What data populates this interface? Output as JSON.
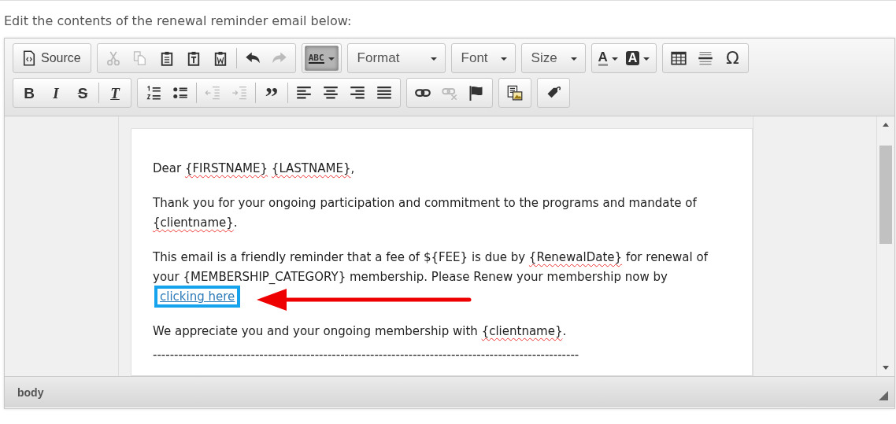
{
  "instruction": "Edit the contents of the renewal reminder email below:",
  "toolbar": [
    [
      [
        {
          "kind": "button",
          "label": "Source"
        }
      ],
      [
        {
          "kind": "icon",
          "disabled": true,
          "pressed": false
        },
        {
          "kind": "icon",
          "disabled": true,
          "pressed": false
        },
        {
          "kind": "icon",
          "disabled": false,
          "pressed": false
        },
        {
          "kind": "icon",
          "disabled": false,
          "pressed": false
        },
        {
          "kind": "icon",
          "disabled": false,
          "pressed": false
        },
        {
          "kind": "separator"
        },
        {
          "kind": "icon",
          "disabled": false,
          "pressed": false
        },
        {
          "kind": "icon",
          "disabled": true,
          "pressed": false
        }
      ],
      [
        {
          "kind": "glyph",
          "text": "ABC",
          "disabled": false,
          "pressed": true
        }
      ],
      [
        {
          "kind": "combo",
          "label": "Format"
        }
      ],
      [
        {
          "kind": "combo",
          "label": "Font"
        }
      ],
      [
        {
          "kind": "combo",
          "label": "Size"
        }
      ],
      [
        {
          "kind": "glyph",
          "text": "A",
          "disabled": false,
          "pressed": false
        },
        {
          "kind": "glyph",
          "text": "A",
          "disabled": false,
          "pressed": false
        }
      ],
      [
        {
          "kind": "icon",
          "disabled": false,
          "pressed": false
        },
        {
          "kind": "icon",
          "disabled": false,
          "pressed": false
        },
        {
          "kind": "glyph",
          "text": "Ω",
          "disabled": false,
          "pressed": false
        }
      ]
    ],
    [
      [
        {
          "kind": "glyph",
          "text": "B",
          "disabled": false,
          "pressed": false
        },
        {
          "kind": "glyph",
          "text": "I",
          "disabled": false,
          "pressed": false
        },
        {
          "kind": "glyph",
          "text": "S",
          "disabled": false,
          "pressed": false
        },
        {
          "kind": "separator"
        },
        {
          "kind": "glyph",
          "text": "T",
          "disabled": false,
          "pressed": false
        }
      ],
      [
        {
          "kind": "icon",
          "disabled": false,
          "pressed": false
        },
        {
          "kind": "icon",
          "disabled": false,
          "pressed": false
        },
        {
          "kind": "separator"
        },
        {
          "kind": "icon",
          "disabled": true,
          "pressed": false
        },
        {
          "kind": "icon",
          "disabled": true,
          "pressed": false
        },
        {
          "kind": "separator"
        },
        {
          "kind": "glyph",
          "text": "”",
          "disabled": false,
          "pressed": false
        },
        {
          "kind": "separator"
        },
        {
          "kind": "icon",
          "disabled": false,
          "pressed": false
        },
        {
          "kind": "icon",
          "disabled": false,
          "pressed": false
        },
        {
          "kind": "icon",
          "disabled": false,
          "pressed": false
        },
        {
          "kind": "icon",
          "disabled": false,
          "pressed": false
        }
      ],
      [
        {
          "kind": "icon",
          "disabled": false,
          "pressed": false
        },
        {
          "kind": "icon",
          "disabled": true,
          "pressed": false
        },
        {
          "kind": "icon",
          "disabled": false,
          "pressed": false
        }
      ],
      [
        {
          "kind": "icon",
          "disabled": false,
          "pressed": false
        }
      ],
      [
        {
          "kind": "icon",
          "disabled": false,
          "pressed": false
        }
      ]
    ]
  ],
  "paragraphs": [
    [
      {
        "text": "Dear "
      },
      {
        "text": "{FIRSTNAME}",
        "misspelled": true
      },
      {
        "text": " {LASTNAME}",
        "misspelled": true
      },
      {
        "text": ","
      }
    ],
    [
      {
        "text": "Thank you for your ongoing participation and commitment to the programs and mandate of "
      },
      {
        "text": "{clientname}",
        "misspelled": true
      },
      {
        "text": "."
      }
    ],
    [
      {
        "text": "This email is a friendly reminder that a fee of ${FEE} is due by "
      },
      {
        "text": "{RenewalDate}",
        "misspelled": true
      },
      {
        "text": " for renewal of your {MEMBERSHIP_CATEGORY} membership. Please Renew your membership now by "
      },
      {
        "kind": "link",
        "text": "clicking here",
        "highlighted": true
      }
    ],
    [
      {
        "text": "We appreciate you and your ongoing membership with "
      },
      {
        "text": "{clientname}",
        "misspelled": true
      },
      {
        "text": "."
      }
    ],
    [
      {
        "text": "----------------------------------------------------------------------------------------------------"
      }
    ]
  ],
  "status_bar": {
    "path": "body"
  }
}
